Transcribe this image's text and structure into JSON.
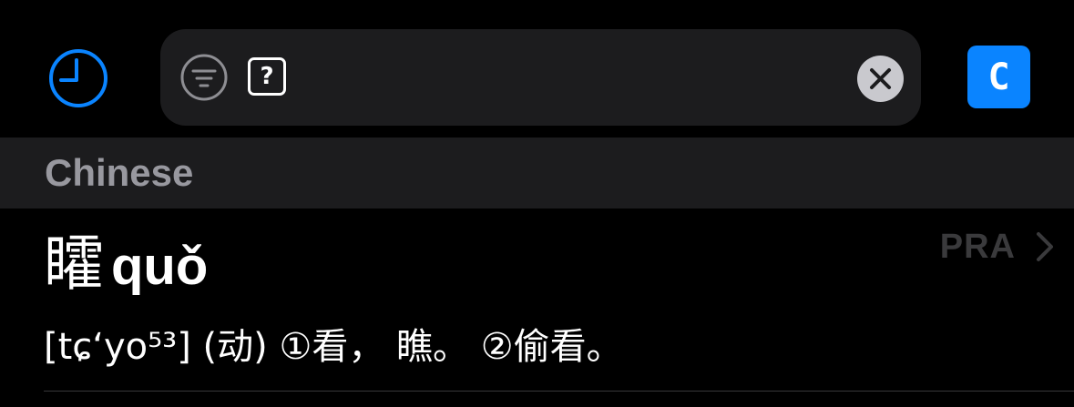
{
  "toolbar": {
    "history_icon": "clock-icon",
    "filter_icon": "filter-icon",
    "query": "?",
    "clear_icon": "clear-icon",
    "language_button": "C"
  },
  "section": {
    "title": "Chinese"
  },
  "entry": {
    "headword": "矐",
    "pinyin": "quǒ",
    "source": "PRA",
    "definition": "[tɕ‘yo⁵³] (动) ①看， 瞧。 ②偷看。"
  },
  "colors": {
    "background": "#000000",
    "surface": "#1c1c1e",
    "accent": "#0a84ff",
    "secondary_text": "#98989f",
    "tertiary_text": "#3a3a3c"
  }
}
